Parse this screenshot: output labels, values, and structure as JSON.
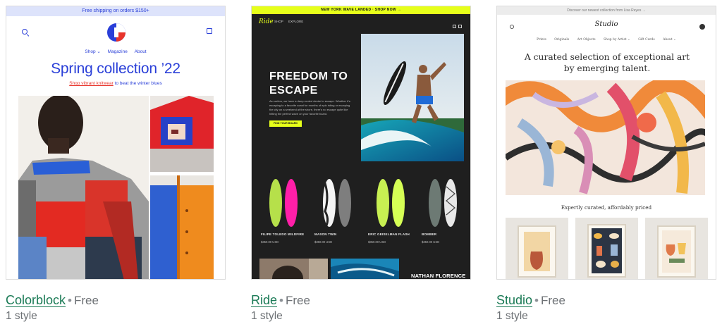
{
  "themes": [
    {
      "name": "Colorblock",
      "price": "Free",
      "styles": "1 style",
      "preview": {
        "announcement": "Free shipping on orders $150+",
        "nav": [
          "Shop ⌄",
          "Magazine",
          "About"
        ],
        "title": "Spring collection ’22",
        "subtitle_link": "Shop vibrant knitwear",
        "subtitle_rest": " to beat the winter blues",
        "colors": {
          "primary": "#2a3fd8",
          "accent": "#e8342b"
        }
      }
    },
    {
      "name": "Ride",
      "price": "Free",
      "styles": "1 style",
      "preview": {
        "announcement": "NEW YORK WAVE LANDED · SHOP NOW →",
        "logo": "Ride",
        "nav": [
          "SHOP",
          "EXPLORE"
        ],
        "hero_title_line1": "FREEDOM TO",
        "hero_title_line2": "ESCAPE",
        "hero_text": "As surfers, we have a deep-rooted desire to escape. Whether it's escaping to a favorite coast for months of epic riding or escaping the city on a weekend at the shore, there's no escape quite like hitting the perfect wave on your favorite board.",
        "hero_button": "FIND YOUR BOARD",
        "products": [
          {
            "name": "FILIPE TOLEDO WILDFIRE",
            "price": "$350.00 USD"
          },
          {
            "name": "MASON TWIN",
            "price": "$350.00 USD"
          },
          {
            "name": "ERIC GEISELMAN FLASH",
            "price": "$350.00 USD"
          },
          {
            "name": "BOMBER",
            "price": "$350.00 USD"
          }
        ],
        "feature_title": "NATHAN FLORENCE",
        "colors": {
          "accent": "#e6ff1a",
          "background": "#1f1f1f"
        }
      }
    },
    {
      "name": "Studio",
      "price": "Free",
      "styles": "1 style",
      "preview": {
        "announcement": "Discover our newest collection from Lisa Reyes →",
        "logo": "Studio",
        "nav": [
          "Prints",
          "Originals",
          "Art Objects",
          "Shop by Artist ⌄",
          "Gift Cards",
          "About ⌄"
        ],
        "title": "A curated selection of exceptional art by emerging talent.",
        "subtitle": "Expertly curated, affordably priced"
      }
    }
  ],
  "separator": "•",
  "colors": {
    "link": "#1a7a55",
    "meta": "#6d7175"
  }
}
